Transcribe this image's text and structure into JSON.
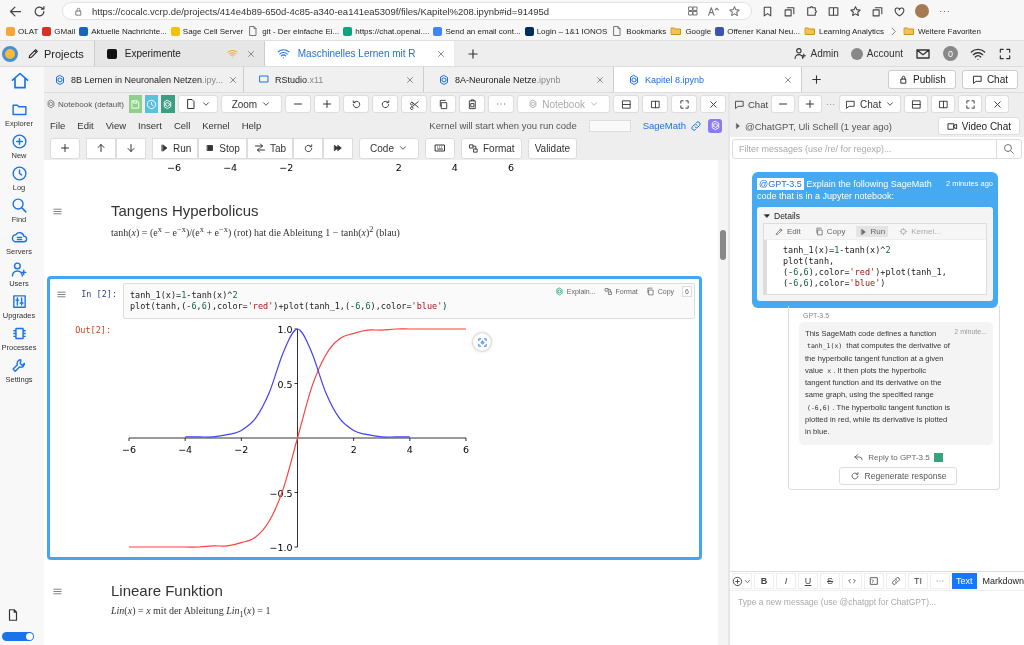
{
  "browser": {
    "url": "https://cocalc.vcrp.de/projects/414e4b89-650d-4c85-a340-ea141ea5309f/files/Kapitel%208.ipynb#id=91495d",
    "bookmarks": [
      {
        "kind": "site",
        "label": "OLAT"
      },
      {
        "kind": "site",
        "label": "GMail"
      },
      {
        "kind": "site",
        "label": "Aktuelle Nachrichte..."
      },
      {
        "kind": "site",
        "label": "Sage Cell Server"
      },
      {
        "kind": "page",
        "label": "git - Der einfache Ei..."
      },
      {
        "kind": "site",
        "label": "https://chat.openai...."
      },
      {
        "kind": "site",
        "label": "Send an email cont..."
      },
      {
        "kind": "site",
        "label": "Login – 1&1 IONOS"
      },
      {
        "kind": "page",
        "label": "Bookmarks"
      },
      {
        "kind": "folder",
        "label": "Google"
      },
      {
        "kind": "site",
        "label": "Offener Kanal Neu..."
      },
      {
        "kind": "folder",
        "label": "Learning Analytics"
      }
    ],
    "more_bookmarks": "Weitere Favoriten"
  },
  "topbar": {
    "projects": "Projects",
    "tabs": [
      {
        "label": "Experimente",
        "selected": false
      },
      {
        "label": "Maschinelles Lernen mit R",
        "selected": true
      }
    ],
    "admin": "Admin",
    "account": "Account",
    "notifications": "0"
  },
  "sidebar_toggle": {
    "on": true
  },
  "sidebar": [
    {
      "label": "Explorer"
    },
    {
      "label": "New"
    },
    {
      "label": "Log"
    },
    {
      "label": "Find"
    },
    {
      "label": "Servers"
    },
    {
      "label": "Users"
    },
    {
      "label": "Upgrades"
    },
    {
      "label": "Processes"
    },
    {
      "label": "Settings"
    }
  ],
  "file_tabs": [
    {
      "name": "8B Lernen in Neuronalen Netzen",
      "ext": ".ipy...",
      "selected": false
    },
    {
      "name": "RStudio",
      "ext": ".x11",
      "selected": false
    },
    {
      "name": "8A-Neuronale Netze",
      "ext": ".ipynb",
      "selected": false
    },
    {
      "name": "Kapitel 8",
      "ext": ".ipynb",
      "selected": true
    }
  ],
  "publish": "Publish",
  "chat_button": "Chat",
  "notebook": {
    "kernel_label": "Notebook (default)",
    "zoom": "Zoom",
    "view": "Notebook",
    "menus": [
      "File",
      "Edit",
      "View",
      "Insert",
      "Cell",
      "Kernel",
      "Help"
    ],
    "kernel_status": "Kernel will start when you run code",
    "kernel_name": "SageMath",
    "cell_toolbar": {
      "run": "Run",
      "stop": "Stop",
      "tab": "Tab",
      "cell_type": "Code",
      "format": "Format",
      "validate": "Validate"
    },
    "previous_plot_ticks": [
      "−6",
      "−4",
      "−2",
      "2",
      "4",
      "6"
    ],
    "heading_cell": {
      "title": "Tangens Hyperbolicus",
      "formula": "tanh(*x*) = (e$^{x}$ − e$^{−x}$)/(e$^{x}$ + e$^{−x}$) (rot) hat die Ableitung 1 − tanh(*x*)$^{2}$ (blau)"
    },
    "code_cell": {
      "prompt_in": "In [2]:",
      "prompt_out": "Out[2]:",
      "selected": true,
      "code": [
        "tanh_1(x)=1-tanh(x)^2",
        "plot(tanh,(-6,6),color='red')+plot(tanh_1,(-6,6),color='blue')"
      ],
      "actions": {
        "explain": "Explain...",
        "format": "Format",
        "copy": "Copy",
        "count": "6"
      },
      "output": {
        "chart_data": {
          "type": "line",
          "x": [
            -6,
            -5.5,
            -5,
            -4.5,
            -4,
            -3.5,
            -3,
            -2.5,
            -2,
            -1.5,
            -1,
            -0.5,
            0,
            0.5,
            1,
            1.5,
            2,
            2.5,
            3,
            3.5,
            4,
            4.5,
            5,
            5.5,
            6
          ],
          "series": [
            {
              "color": "#ff4040",
              "values": [
                -1,
                -1,
                -1,
                -1,
                -1,
                -1,
                -0.99,
                -0.99,
                -0.96,
                -0.91,
                -0.76,
                -0.46,
                0,
                0.46,
                0.76,
                0.91,
                0.96,
                0.99,
                0.99,
                1,
                1,
                1,
                1,
                1,
                1
              ]
            },
            {
              "color": "#4040ff",
              "values": [
                null,
                null,
                null,
                null,
                0.01,
                0.01,
                0.01,
                0.03,
                0.07,
                0.18,
                0.42,
                0.79,
                1,
                0.79,
                0.42,
                0.18,
                0.07,
                0.03,
                0.01,
                0.01,
                0.01,
                null,
                null,
                null,
                null
              ]
            }
          ],
          "xlim": [
            -6,
            6
          ],
          "ylim": [
            -1,
            1
          ],
          "xticks": [
            {
              "value": -6,
              "label": "−6"
            },
            {
              "value": -4,
              "label": "−4"
            },
            {
              "value": -2,
              "label": "−2"
            },
            {
              "value": 2,
              "label": "2"
            },
            {
              "value": 4,
              "label": "4"
            },
            {
              "value": 6,
              "label": "6"
            }
          ],
          "yticks": [
            {
              "value": -1,
              "label": "−1.0"
            },
            {
              "value": -0.5,
              "label": "−0.5"
            },
            {
              "value": 0.5,
              "label": "0.5"
            },
            {
              "value": 1,
              "label": "1.0"
            }
          ]
        }
      }
    },
    "second_heading_cell": {
      "title": "Lineare Funktion",
      "formula": "*Lin*(*x*) = *x* mit der Ableitung *Lin*$_{1}$(*x*) = 1"
    }
  },
  "chat": {
    "title": "Chat",
    "mode": "Chat",
    "thread": "@ChatGPT, Uli Schell (1 year ago)",
    "video_chat": "Video Chat",
    "filter_placeholder": "Filter messages (use /re/ for regexp)...",
    "question": {
      "mention": "@GPT-3.5",
      "text": "Explain the following SageMath code that is in a Jupyter notebook:",
      "time": "2 minutes ago",
      "details": {
        "label": "Details",
        "expanded": true,
        "edit": "Edit",
        "copy": "Copy",
        "run": "Run",
        "kernel": "Kernel...",
        "code": [
          "tanh_1(x)=1-tanh(x)^2",
          "plot(tanh,",
          "(-6,6),color='red')+plot(tanh_1,",
          "(-6,6),color='blue')"
        ]
      }
    },
    "answer": {
      "author": "GPT-3.5",
      "time": "2 minute...",
      "segments": [
        {
          "kind": "text",
          "text": "This SageMath code defines a function "
        },
        {
          "kind": "code",
          "text": "tanh_1(x)"
        },
        {
          "kind": "text",
          "text": " that computes the derivative of the hyperbolic tangent function at a given value "
        },
        {
          "kind": "code",
          "text": "x"
        },
        {
          "kind": "text",
          "text": ". It then plots the hyperbolic tangent function and its derivative on the same graph, using the specified range "
        },
        {
          "kind": "code",
          "text": "(-6,6)"
        },
        {
          "kind": "text",
          "text": ". The hyperbolic tangent function is plotted in red, while its derivative is plotted in blue."
        }
      ],
      "reply": "Reply to GPT-3.5",
      "regenerate": "Regenerate response"
    },
    "composer": {
      "format_buttons": [
        "B",
        "I",
        "U",
        "S"
      ],
      "size_button": "TI",
      "modes": [
        {
          "label": "Text",
          "selected": true
        },
        {
          "label": "Markdown",
          "selected": false
        }
      ],
      "placeholder": "Type a new message (use @chatgpt for ChatGPT)..."
    }
  }
}
